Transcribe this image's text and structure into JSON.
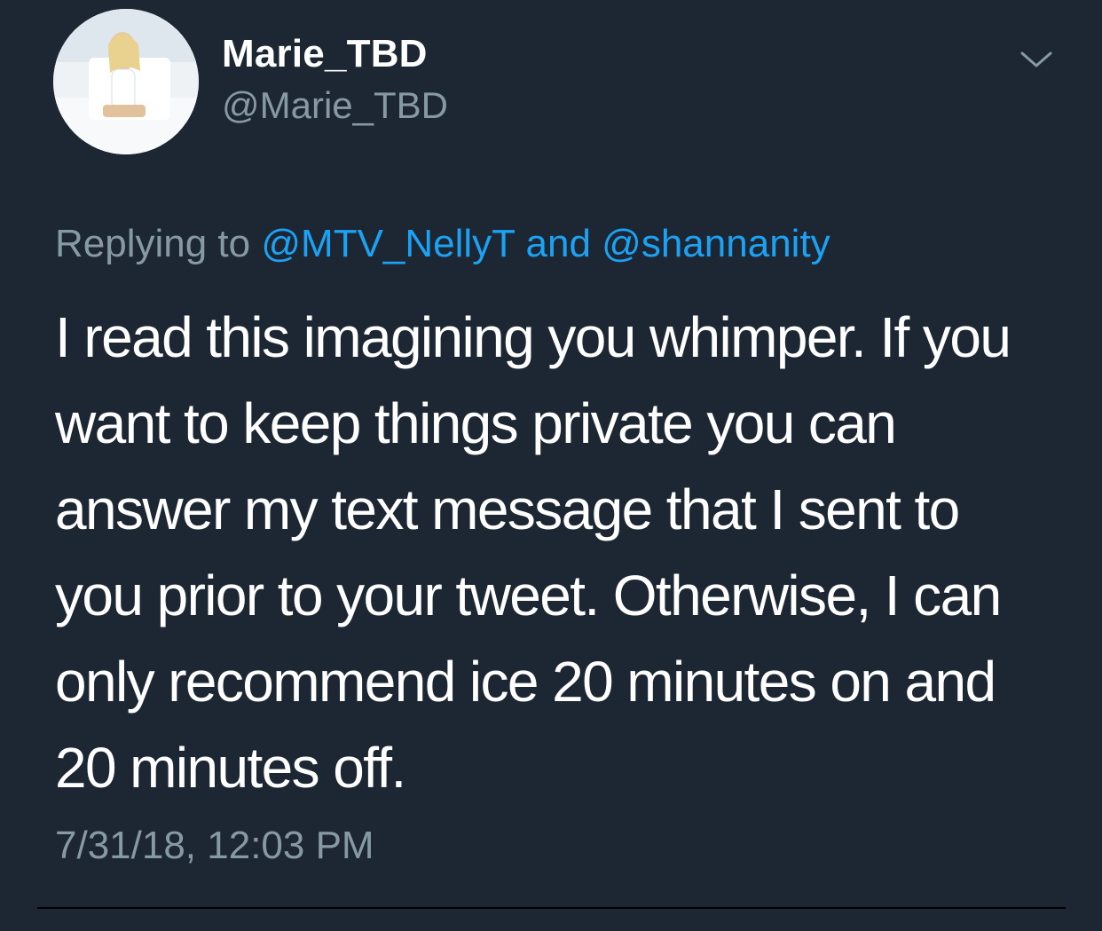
{
  "author": {
    "display_name": "Marie_TBD",
    "handle": "@Marie_TBD"
  },
  "reply": {
    "prefix": "Replying to",
    "mention_1": "@MTV_NellyT",
    "conjunction": "and",
    "mention_2": "@shannanity"
  },
  "tweet": {
    "lines": [
      "I read this imagining you whimper. If you",
      "want to keep things private you can",
      "answer my text message that I sent to",
      "you prior to your tweet. Otherwise, I can",
      "only recommend ice 20 minutes on and",
      "20 minutes off."
    ],
    "timestamp": "7/31/18, 12:03 PM"
  },
  "icons": {
    "avatar": "profile-photo",
    "menu": "chevron-down-icon"
  },
  "colors": {
    "background": "#1c2733",
    "text": "#ffffff",
    "secondary_text": "#8899a6",
    "link": "#1da1f2"
  }
}
